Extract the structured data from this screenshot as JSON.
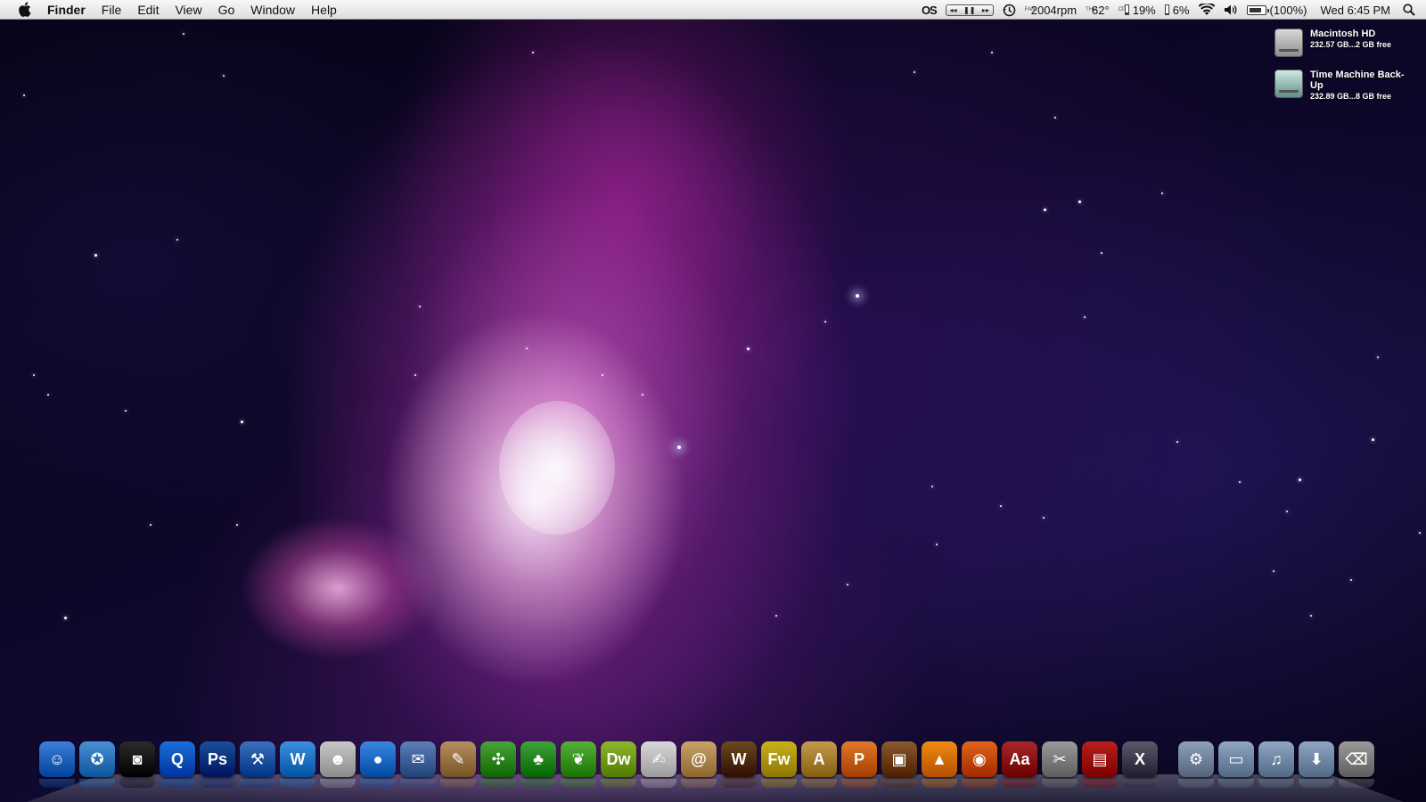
{
  "menubar": {
    "app_name": "Finder",
    "menus": [
      "File",
      "Edit",
      "View",
      "Go",
      "Window",
      "Help"
    ],
    "status": {
      "extra_label": "OS",
      "media_controls": [
        "◂◂",
        "❚❚",
        "▸▸"
      ],
      "fan": "2004rpm",
      "fan_tag": "FAN",
      "temp": "62°",
      "temp_tag": "THM",
      "cpu": "19%",
      "cpu_tag": "CPU",
      "mem": "6%",
      "battery": "(100%)",
      "clock": "Wed 6:45 PM"
    }
  },
  "desktop": {
    "volumes": [
      {
        "name": "Macintosh HD",
        "info": "232.57 GB...2 GB free",
        "icon": "hard-drive-icon"
      },
      {
        "name": "Time Machine Back-Up",
        "info": "232.89 GB...8 GB free",
        "icon": "time-machine-drive-icon"
      }
    ]
  },
  "dock": {
    "apps": [
      {
        "name": "finder",
        "glyph": "☺",
        "color": "#3d7fd8"
      },
      {
        "name": "safari",
        "glyph": "✪",
        "color": "#4a90d6"
      },
      {
        "name": "photo-booth",
        "glyph": "◙",
        "color": "#2b2b2b"
      },
      {
        "name": "quicktime",
        "glyph": "Q",
        "color": "#1b6fd9"
      },
      {
        "name": "photoshop",
        "glyph": "Ps",
        "color": "#1a4f9a"
      },
      {
        "name": "xcode",
        "glyph": "⚒",
        "color": "#3c6fbf"
      },
      {
        "name": "dreamweaver-w",
        "glyph": "W",
        "color": "#3e8fe0"
      },
      {
        "name": "ichat-head",
        "glyph": "☻",
        "color": "#c8c8c8"
      },
      {
        "name": "ichat",
        "glyph": "●",
        "color": "#3a86e0"
      },
      {
        "name": "preview",
        "glyph": "✉",
        "color": "#5d7fb8"
      },
      {
        "name": "iphoto",
        "glyph": "✎",
        "color": "#b49060"
      },
      {
        "name": "network",
        "glyph": "✣",
        "color": "#4aa33a"
      },
      {
        "name": "adium",
        "glyph": "♣",
        "color": "#3fa23b"
      },
      {
        "name": "coda",
        "glyph": "❦",
        "color": "#55b13a"
      },
      {
        "name": "dreamweaver",
        "glyph": "Dw",
        "color": "#8cb82d"
      },
      {
        "name": "textedit",
        "glyph": "✍",
        "color": "#d8d8d8"
      },
      {
        "name": "address-book",
        "glyph": "@",
        "color": "#c9a36a"
      },
      {
        "name": "world-of-warcraft",
        "glyph": "W",
        "color": "#6b4a1f"
      },
      {
        "name": "fireworks",
        "glyph": "Fw",
        "color": "#c9b21a"
      },
      {
        "name": "app-store-a",
        "glyph": "A",
        "color": "#c49a4c"
      },
      {
        "name": "pages",
        "glyph": "P",
        "color": "#e07a2a"
      },
      {
        "name": "image-capture",
        "glyph": "▣",
        "color": "#8a5a30"
      },
      {
        "name": "vlc",
        "glyph": "▲",
        "color": "#f08b12"
      },
      {
        "name": "firefox",
        "glyph": "◉",
        "color": "#e0651a"
      },
      {
        "name": "dictionary",
        "glyph": "Aa",
        "color": "#a8282a"
      },
      {
        "name": "script-editor",
        "glyph": "✂",
        "color": "#9a9a9a"
      },
      {
        "name": "photo-stack",
        "glyph": "▤",
        "color": "#b8201c"
      },
      {
        "name": "osx",
        "glyph": "X",
        "color": "#5a5a6a"
      }
    ],
    "stacks": [
      {
        "name": "applications-stack",
        "glyph": "⚙",
        "color": "#8fa0b8"
      },
      {
        "name": "documents-stack",
        "glyph": "▭",
        "color": "#8fa6c2"
      },
      {
        "name": "music-stack",
        "glyph": "♫",
        "color": "#8fa6c2"
      },
      {
        "name": "downloads-stack",
        "glyph": "⬇",
        "color": "#8fa6c2"
      },
      {
        "name": "trash",
        "glyph": "⌫",
        "color": "#9a9a9a"
      }
    ]
  }
}
